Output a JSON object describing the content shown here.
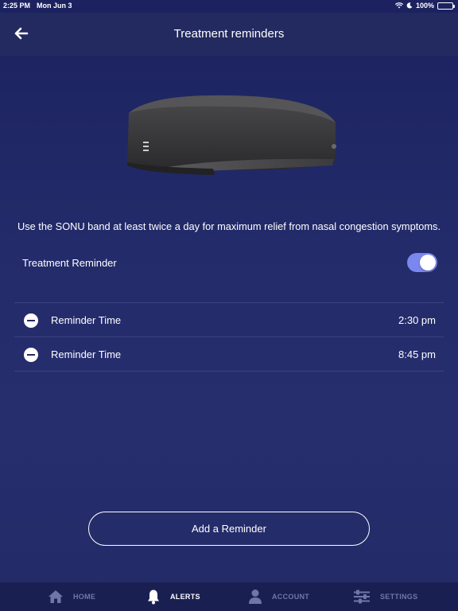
{
  "status_bar": {
    "time": "2:25 PM",
    "date": "Mon Jun 3",
    "battery": "100%"
  },
  "header": {
    "title": "Treatment reminders",
    "back_icon": "arrow-left-icon"
  },
  "description": "Use the SONU band at least twice a day for maximum relief from nasal congestion symptoms.",
  "treatment_toggle": {
    "label": "Treatment Reminder",
    "enabled": true
  },
  "reminders": [
    {
      "label": "Reminder Time",
      "time": "2:30 pm"
    },
    {
      "label": "Reminder Time",
      "time": "8:45 pm"
    }
  ],
  "add_button": {
    "label": "Add a Reminder"
  },
  "tabs": [
    {
      "label": "HOME",
      "icon": "home-icon",
      "active": false
    },
    {
      "label": "ALERTS",
      "icon": "bell-icon",
      "active": true
    },
    {
      "label": "ACCOUNT",
      "icon": "person-icon",
      "active": false
    },
    {
      "label": "SETTINGS",
      "icon": "sliders-icon",
      "active": false
    }
  ],
  "colors": {
    "background": "#232b6a",
    "toggle_on": "#7a87ee",
    "tab_inactive": "#6f77a8"
  }
}
